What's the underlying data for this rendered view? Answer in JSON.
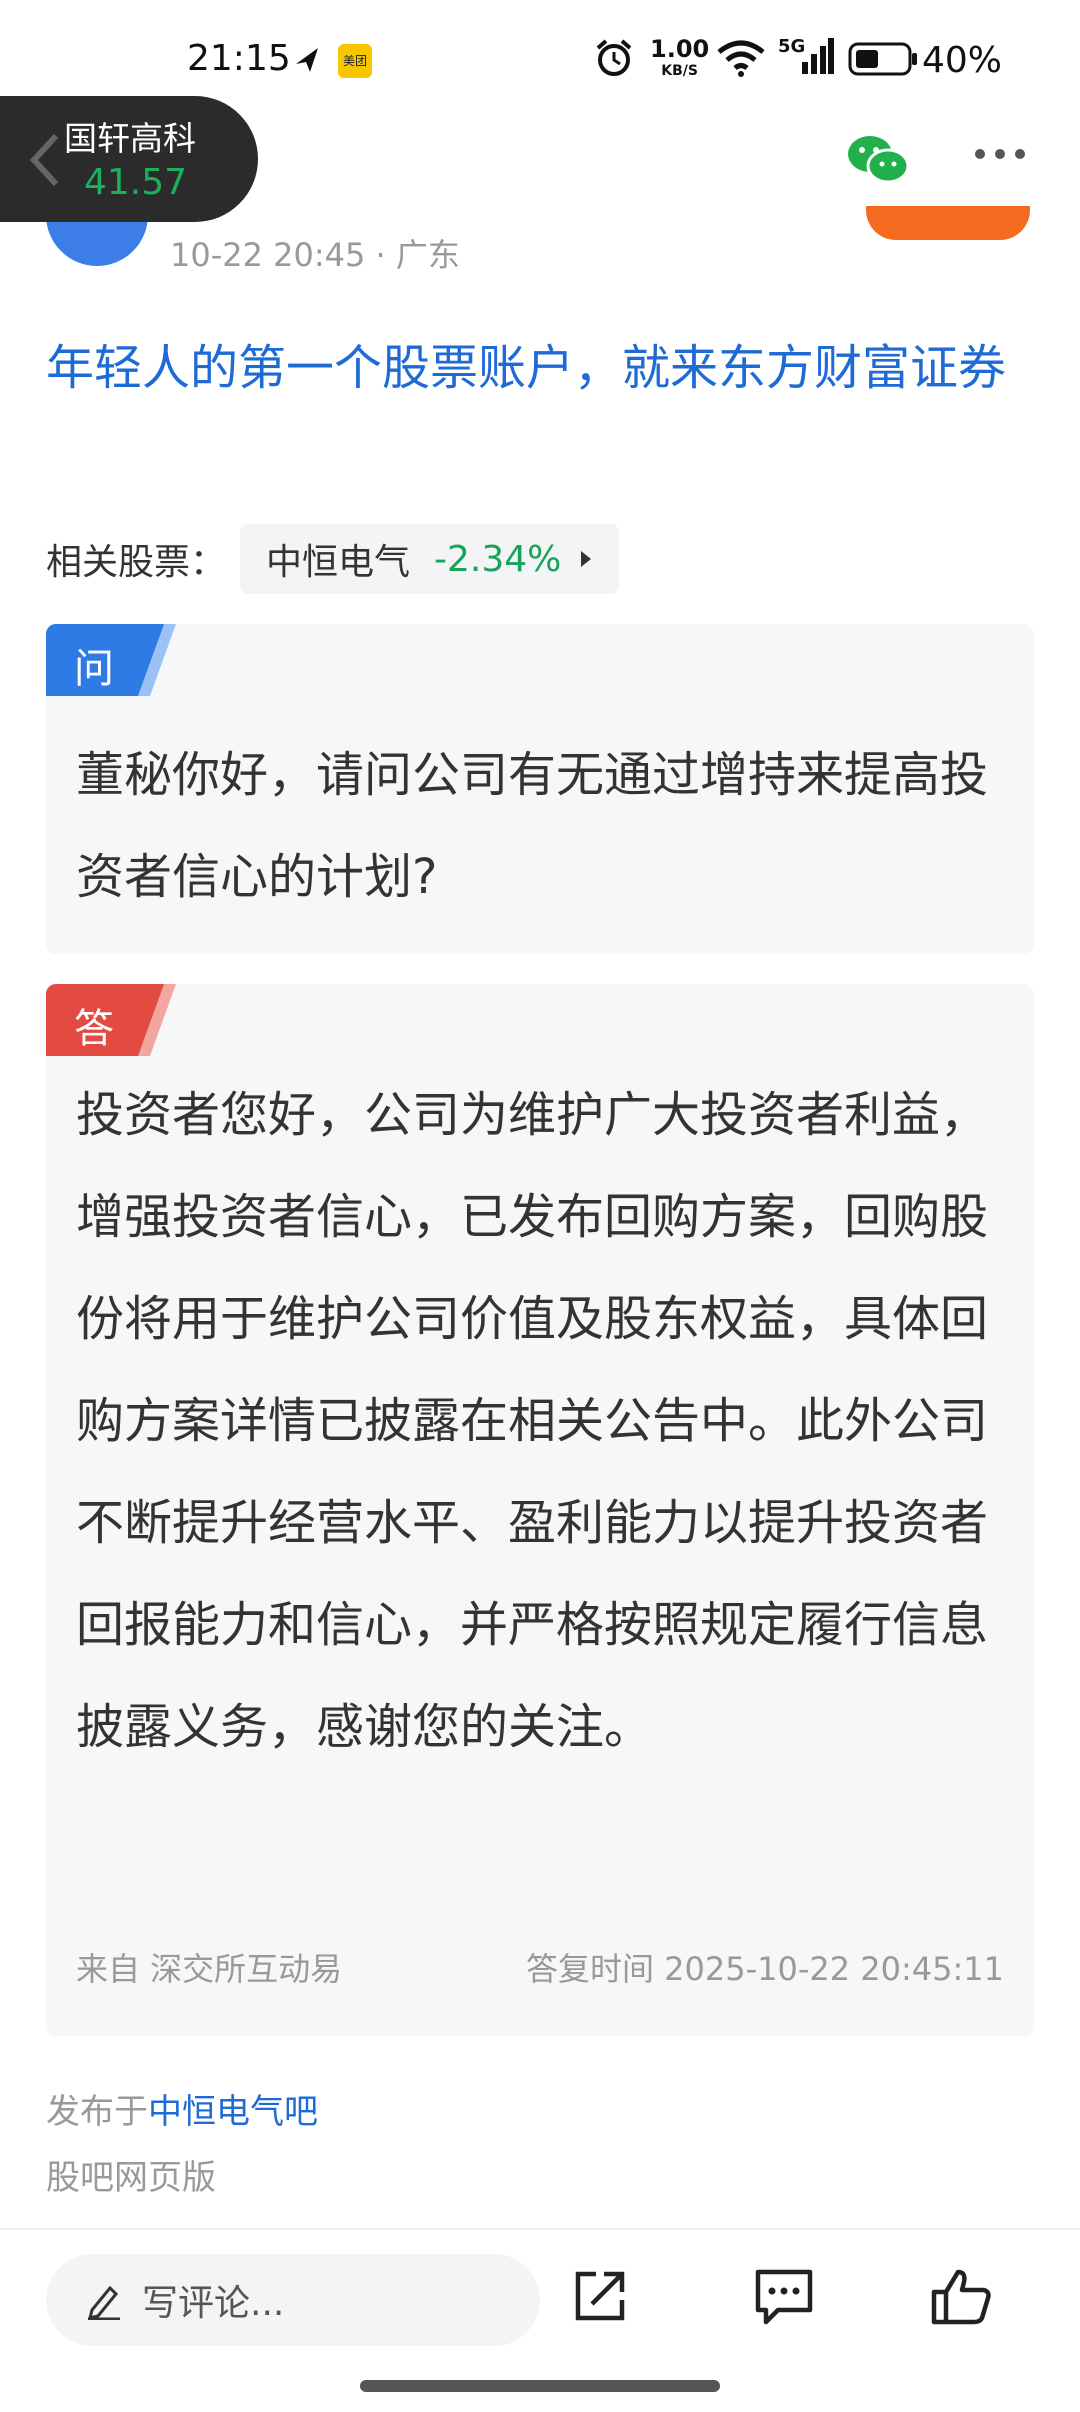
{
  "status_bar": {
    "time": "21:15",
    "meituan_label": "美团",
    "net_speed_value": "1.00",
    "net_speed_unit": "KB/S",
    "network": "5G",
    "battery_text": "40%",
    "icons": [
      "navigation-icon",
      "meituan-icon",
      "alarm-icon",
      "wifi-icon",
      "signal-5g-icon",
      "battery-icon"
    ]
  },
  "header": {
    "stock_name": "国轩高科",
    "stock_price": "41.57",
    "icons": [
      "back-arrow-icon",
      "wechat-icon",
      "more-icon"
    ]
  },
  "post": {
    "meta": "10-22 20:45 · 广东",
    "title": "年轻人的第一个股票账户，就来东方财富证券",
    "related_label": "相关股票：",
    "related_stock_name": "中恒电气",
    "related_stock_change": "-2.34%"
  },
  "question": {
    "tag": "问",
    "text": "董秘你好，请问公司有无通过增持来提高投资者信心的计划?"
  },
  "answer": {
    "tag": "答",
    "text": "投资者您好，公司为维护广大投资者利益，增强投资者信心，已发布回购方案，回购股份将用于维护公司价值及股东权益，具体回购方案详情已披露在相关公告中。此外公司不断提升经营水平、盈利能力以提升投资者回报能力和信心，并严格按照规定履行信息披露义务，感谢您的关注。",
    "source": "来自 深交所互动易",
    "reply_time": "答复时间 2025-10-22 20:45:11"
  },
  "footer": {
    "published_prefix": "发布于",
    "board_name": "中恒电气吧",
    "web_version": "股吧网页版"
  },
  "bottom_bar": {
    "comment_placeholder": "写评论..."
  },
  "colors": {
    "link_blue": "#1e6bd6",
    "change_green": "#19a35a",
    "question_tag_blue": "#2f7be6",
    "answer_tag_red": "#e24a42"
  }
}
